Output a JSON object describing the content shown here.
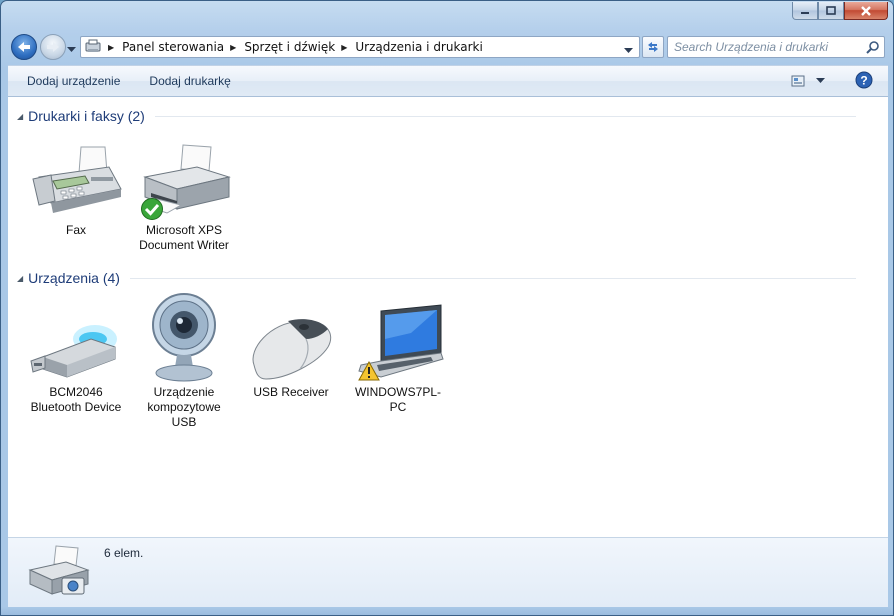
{
  "window": {
    "minimize": "minimize-icon",
    "maximize": "maximize-icon",
    "close": "close-icon"
  },
  "breadcrumb": [
    {
      "label": "Panel sterowania"
    },
    {
      "label": "Sprzęt i dźwięk"
    },
    {
      "label": "Urządzenia i drukarki"
    }
  ],
  "search": {
    "placeholder": "Search Urządzenia i drukarki"
  },
  "toolbar": {
    "add_device": "Dodaj urządzenie",
    "add_printer": "Dodaj drukarkę"
  },
  "groups": [
    {
      "title": "Drukarki i faksy (2)",
      "items": [
        {
          "label": "Fax",
          "icon": "fax-icon"
        },
        {
          "label": "Microsoft XPS Document Writer",
          "icon": "printer-icon",
          "badge": "default-check-icon"
        }
      ]
    },
    {
      "title": "Urządzenia (4)",
      "items": [
        {
          "label": "BCM2046 Bluetooth Device",
          "icon": "usb-dongle-icon"
        },
        {
          "label": "Urządzenie kompozytowe USB",
          "icon": "webcam-icon"
        },
        {
          "label": "USB Receiver",
          "icon": "mouse-icon"
        },
        {
          "label": "WINDOWS7PL-PC",
          "icon": "laptop-icon",
          "badge": "warning-icon"
        }
      ]
    }
  ],
  "details": {
    "count": "6 elem."
  },
  "colors": {
    "accent": "#1e3c78",
    "toolbar_text": "#1e395b"
  }
}
